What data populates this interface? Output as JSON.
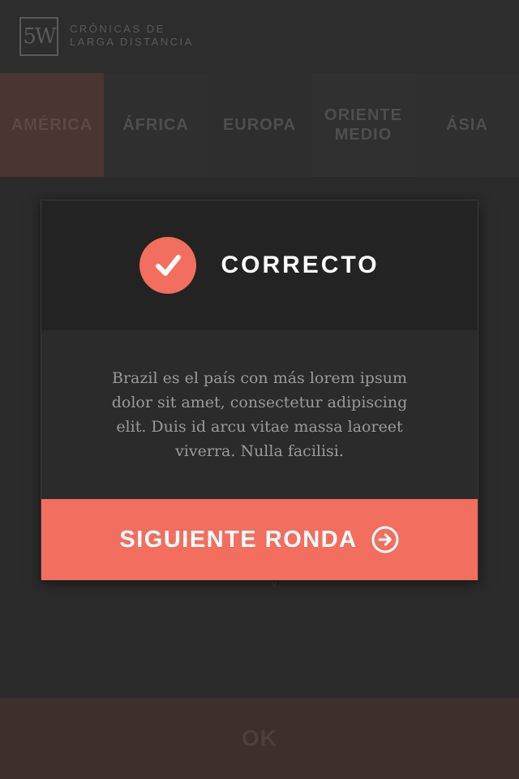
{
  "header": {
    "logo_text": "5W",
    "brand_line1": "CRÓNICAS DE",
    "brand_line2": "LARGA DISTANCIA"
  },
  "tabs": [
    {
      "label": "AMÉRICA",
      "active": true
    },
    {
      "label": "ÁFRICA",
      "active": false
    },
    {
      "label": "EUROPA",
      "active": false
    },
    {
      "label": "ORIENTE MEDIO",
      "active": false
    },
    {
      "label": "ÁSIA",
      "active": false
    }
  ],
  "modal": {
    "title": "CORRECTO",
    "body": "Brazil es el país con más lorem ipsum dolor sit amet, consectetur adipiscing elit. Duis id arcu vitae massa laoreet viverra. Nulla facilisi.",
    "button_label": "SIGUIENTE RONDA",
    "icons": {
      "status": "check-icon",
      "button": "arrow-right-circle-icon"
    }
  },
  "ok_button": {
    "label": "OK"
  },
  "colors": {
    "accent": "#f26e5e",
    "background": "#2b2b2b",
    "modal_header": "#232323"
  }
}
